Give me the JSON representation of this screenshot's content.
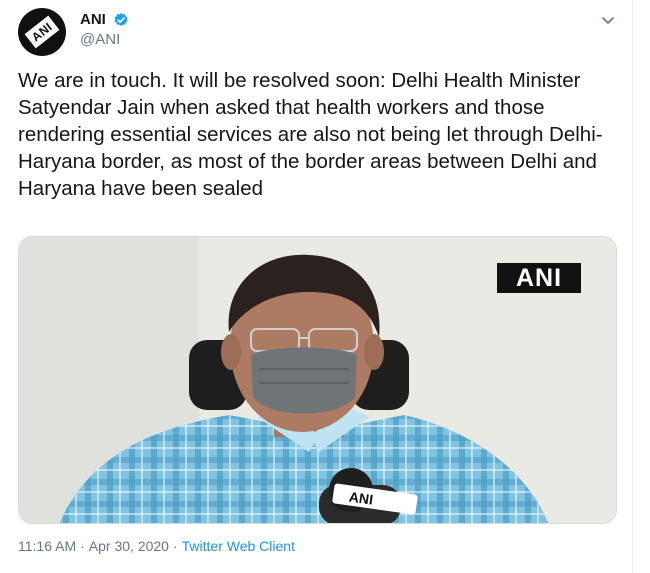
{
  "author": {
    "name": "ANI",
    "handle": "@ANI",
    "avatar_logo_text": "ANI",
    "verified": true
  },
  "tweet": {
    "text": "We are in touch. It will be resolved soon: Delhi Health Minister Satyendar Jain when asked that health workers and those rendering essential services are also not being let through Delhi-Haryana border, as most of the border areas between Delhi and Haryana have been sealed"
  },
  "media": {
    "watermark": "ANI",
    "mic_label": "ANI"
  },
  "meta": {
    "time": "11:16 AM",
    "date": "Apr 30, 2020",
    "separator": "·",
    "client": "Twitter Web Client"
  },
  "icons": {
    "verified": "verified-badge-icon",
    "menu": "chevron-down-icon"
  },
  "colors": {
    "accent": "#1da1f2",
    "link": "#1b95e0",
    "secondary_text": "#657786",
    "text": "#14171a"
  }
}
